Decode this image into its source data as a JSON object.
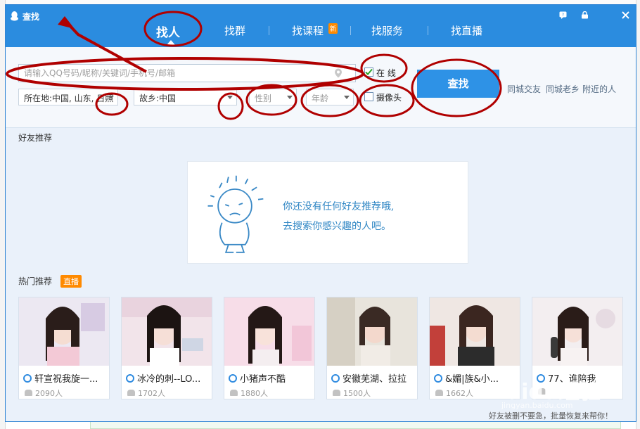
{
  "window": {
    "title": "查找",
    "logo_icon": "qq-penguin-icon"
  },
  "tabs": [
    {
      "label": "找人",
      "active": true
    },
    {
      "label": "找群"
    },
    {
      "label": "找课程",
      "badge": "新"
    },
    {
      "label": "找服务"
    },
    {
      "label": "找直播"
    }
  ],
  "window_controls": [
    "feedback-icon",
    "lock-icon",
    "close-icon"
  ],
  "search": {
    "placeholder": "请输入QQ号码/昵称/关键词/手机号/邮箱",
    "online_label": "在  线",
    "online_checked": true,
    "camera_label": "摄像头",
    "camera_checked": false,
    "location_label": "所在地:中国, 山东, 日照",
    "hometown_label": "故乡:中国",
    "gender_placeholder": "性别",
    "age_placeholder": "年龄",
    "find_button": "查找",
    "quick_links": [
      "同城交友",
      "同城老乡",
      "附近的人"
    ]
  },
  "friend_recommend": {
    "title": "好友推荐",
    "empty_line1": "你还没有任何好友推荐哦,",
    "empty_line2": "去搜索你感兴趣的人吧。"
  },
  "hot": {
    "title": "热门推荐",
    "badge": "直播",
    "cards": [
      {
        "name": "轩宣祝我旋一...",
        "count": "2090人"
      },
      {
        "name": "冰冷的刺--LO...",
        "count": "1702人"
      },
      {
        "name": "小猪声不酷",
        "count": "1880人"
      },
      {
        "name": "安徽芜湖、拉拉",
        "count": "1500人"
      },
      {
        "name": "&媚|族&小...",
        "count": "1662人"
      },
      {
        "name": "77、谁陪我",
        "count": ""
      }
    ]
  },
  "footer_note": "好友被删不要急，批量恢复来帮你！",
  "watermark": "Baidu经验",
  "watermark_sub": "jingyan.baidu.com",
  "colors": {
    "titlebar": "#2b8cdf",
    "find_button": "#2e92e6",
    "annotation": "#b00000",
    "badge": "#ff8a00"
  }
}
